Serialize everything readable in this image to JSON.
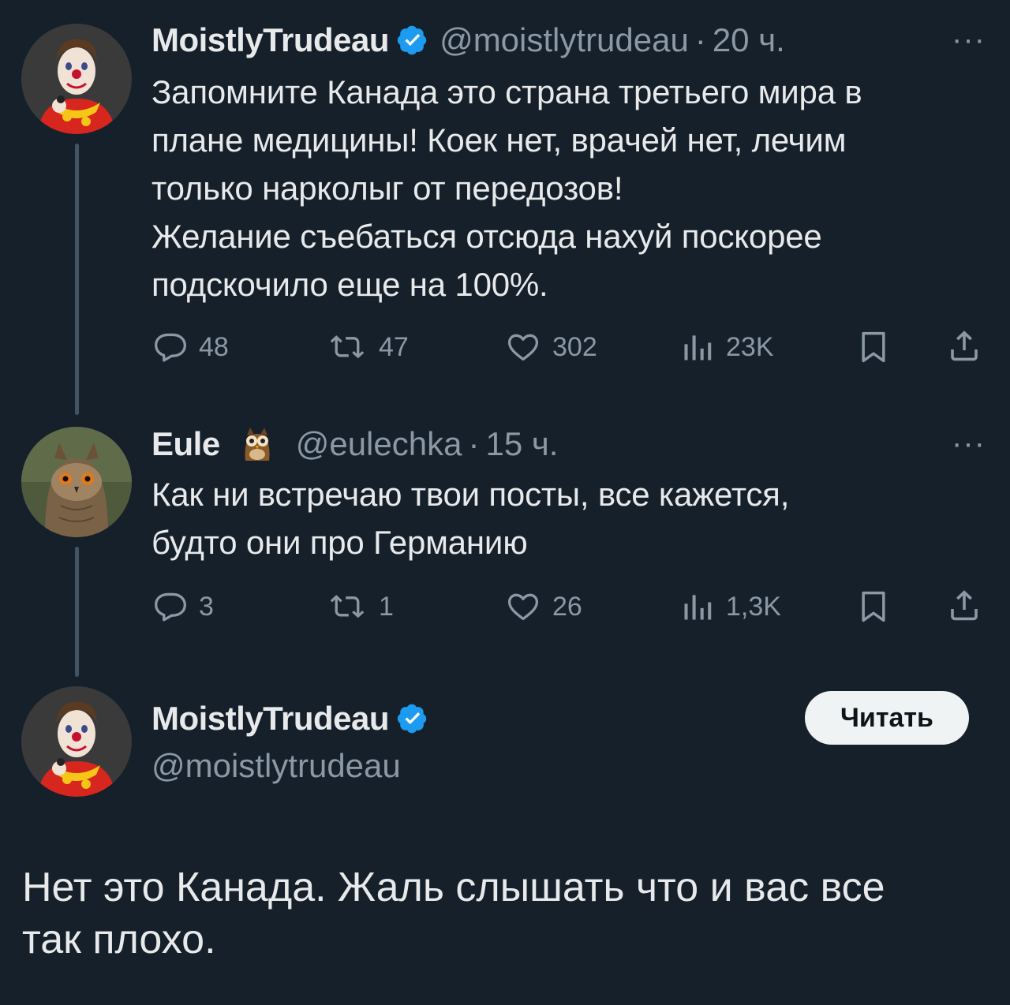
{
  "colors": {
    "background": "#15202b",
    "primary_text": "#e7e9ea",
    "secondary_text": "#8b98a5",
    "verified_blue": "#1d9bf0",
    "button_bg": "#eff3f4"
  },
  "tweet1": {
    "name": "MoistlyTrudeau",
    "verified": true,
    "handle": "@moistlytrudeau",
    "time": "20 ч.",
    "text": "Запомните Канада это страна третьего мира в\nплане медицины! Коек нет, врачей нет, лечим\nтолько нарколыг от передозов!\nЖелание съебаться отсюда нахуй поскорее\nподскочило еще на 100%.",
    "stats": {
      "replies": "48",
      "reposts": "47",
      "likes": "302",
      "views": "23K"
    }
  },
  "tweet2": {
    "name": "Eule",
    "name_emoji": "owl",
    "handle": "@eulechka",
    "time": "15 ч.",
    "text": "Как ни встречаю твои посты, все кажется,\nбудто они про Германию",
    "stats": {
      "replies": "3",
      "reposts": "1",
      "likes": "26",
      "views": "1,3K"
    }
  },
  "reply": {
    "name": "MoistlyTrudeau",
    "verified": true,
    "handle": "@moistlytrudeau",
    "follow_label": "Читать",
    "text": "Нет это Канада. Жаль слышать что и вас все\nтак плохо."
  },
  "icons": [
    "reply-icon",
    "repost-icon",
    "like-icon",
    "views-icon",
    "bookmark-icon",
    "share-icon",
    "more-icon",
    "verified-badge-icon"
  ]
}
